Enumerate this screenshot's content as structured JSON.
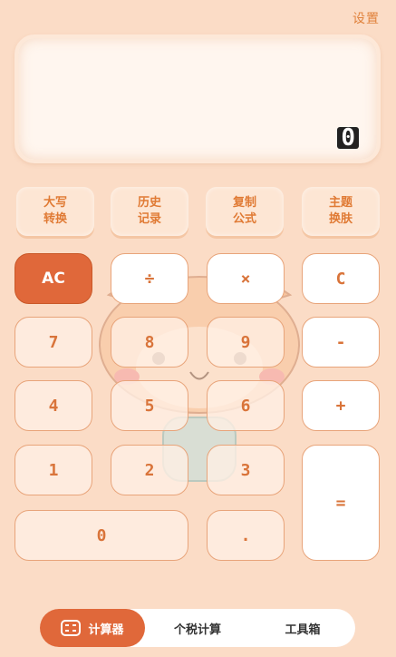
{
  "header": {
    "settings_label": "设置"
  },
  "display": {
    "value": "0"
  },
  "functions": [
    {
      "line1": "大写",
      "line2": "转换"
    },
    {
      "line1": "历史",
      "line2": "记录"
    },
    {
      "line1": "复制",
      "line2": "公式"
    },
    {
      "line1": "主题",
      "line2": "换肤"
    }
  ],
  "keys": {
    "ac": "AC",
    "divide": "÷",
    "multiply": "×",
    "clear": "C",
    "seven": "7",
    "eight": "8",
    "nine": "9",
    "minus": "-",
    "four": "4",
    "five": "5",
    "six": "6",
    "plus": "+",
    "one": "1",
    "two": "2",
    "three": "3",
    "equals": "=",
    "zero": "0",
    "decimal": "."
  },
  "nav": {
    "items": [
      {
        "label": "计算器",
        "icon": "calculator-icon",
        "active": true
      },
      {
        "label": "个税计算",
        "active": false
      },
      {
        "label": "工具箱",
        "active": false
      }
    ]
  },
  "colors": {
    "background": "#fbdcc6",
    "accent": "#e0683a",
    "text_accent": "#d9743a"
  }
}
